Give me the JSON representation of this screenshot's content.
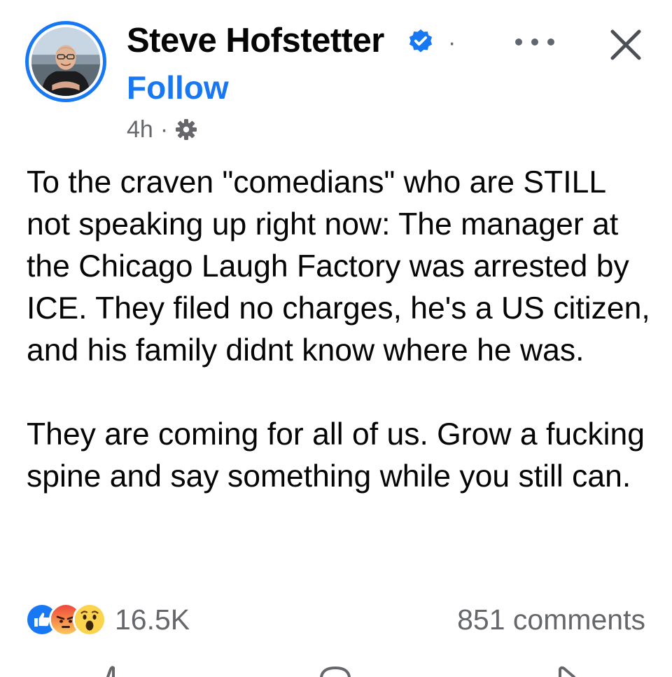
{
  "post": {
    "author": {
      "name": "Steve Hofstetter",
      "follow_label": "Follow",
      "verified": true,
      "name_separator": "·"
    },
    "timestamp": "4h",
    "meta_separator": "·",
    "audience_icon": "gear-icon",
    "text_paragraphs": [
      "To the craven \"comedians\" who are STILL not speaking up right now: The manager at the Chicago Laugh Factory was arrested by ICE. They filed no charges, he's a US citizen, and his family didnt know where he was.",
      "They are coming for all of us. Grow a fucking spine and say something while you still can."
    ],
    "reactions": {
      "types": [
        "like",
        "angry",
        "wow"
      ],
      "count": "16.5K"
    },
    "comments_count": "851 comments"
  },
  "colors": {
    "brand_blue": "#1877f2",
    "secondary_text": "#65676b",
    "primary_text": "#050505"
  }
}
